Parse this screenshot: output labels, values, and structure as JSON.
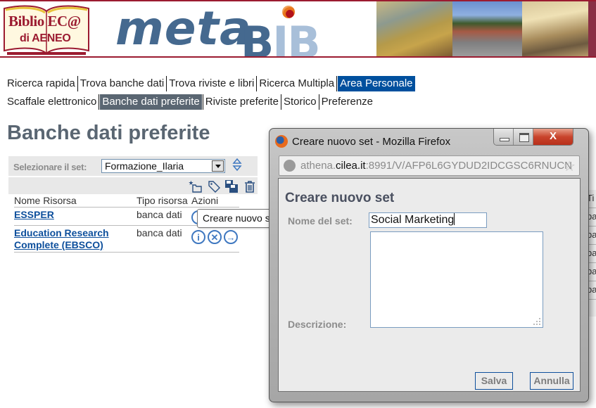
{
  "banner": {
    "library_logo_line1": "Biblio EC@",
    "library_logo_line2": "di AENEO",
    "product_logo_meta": "meta",
    "product_logo_bib": "BiB"
  },
  "nav": {
    "primary": [
      {
        "label": "Ricerca rapida",
        "active": false
      },
      {
        "label": "Trova banche dati",
        "active": false
      },
      {
        "label": "Trova riviste e libri",
        "active": false
      },
      {
        "label": "Ricerca Multipla",
        "active": false
      },
      {
        "label": "Area Personale",
        "active": true
      }
    ],
    "secondary": [
      {
        "label": "Scaffale elettronico",
        "active": false
      },
      {
        "label": "Banche dati preferite",
        "active": true
      },
      {
        "label": "Riviste preferite",
        "active": false
      },
      {
        "label": "Storico",
        "active": false
      },
      {
        "label": "Preferenze",
        "active": false
      }
    ]
  },
  "page": {
    "title": "Banche dati preferite",
    "set_selector": {
      "label": "Selezionare il set:",
      "selected": "Formazione_Ilaria"
    },
    "toolbar_icons": [
      "new-set-icon",
      "tag-icon",
      "save-icon",
      "trash-icon"
    ],
    "table": {
      "columns": [
        "Nome Risorsa",
        "Tipo risorsa",
        "Azioni"
      ],
      "rows": [
        {
          "name": "ESSPER",
          "type": "banca dati"
        },
        {
          "name_line1": "Education Research",
          "name_line2": "Complete (EBSCO)",
          "type": "banca dati"
        }
      ],
      "action_icons": [
        "info-icon",
        "remove-icon",
        "go-icon"
      ]
    },
    "tooltip": "Creare nuovo set",
    "background_right_fragments": [
      "Ti",
      "ba",
      "ba",
      "ba",
      "ba",
      "ba",
      "ba"
    ]
  },
  "popup": {
    "window_title": "Creare nuovo set - Mozilla Firefox",
    "url_prefix": "athena.",
    "url_domain": "cilea.it",
    "url_suffix": ":8991/V/AFP6L6GYDUD2IDCGSC6RNUCN",
    "close_glyph": "X",
    "heading": "Creare nuovo set",
    "name_label": "Nome del set:",
    "name_value": "Social Marketing",
    "description_label": "Descrizione:",
    "description_value": "",
    "save_label": "Salva",
    "cancel_label": "Annulla"
  },
  "colors": {
    "banner_border": "#9b1b30",
    "nav_active_primary": "#00509e",
    "nav_active_secondary": "#5a6672",
    "link": "#0d4f9c",
    "title": "#5a6672"
  }
}
